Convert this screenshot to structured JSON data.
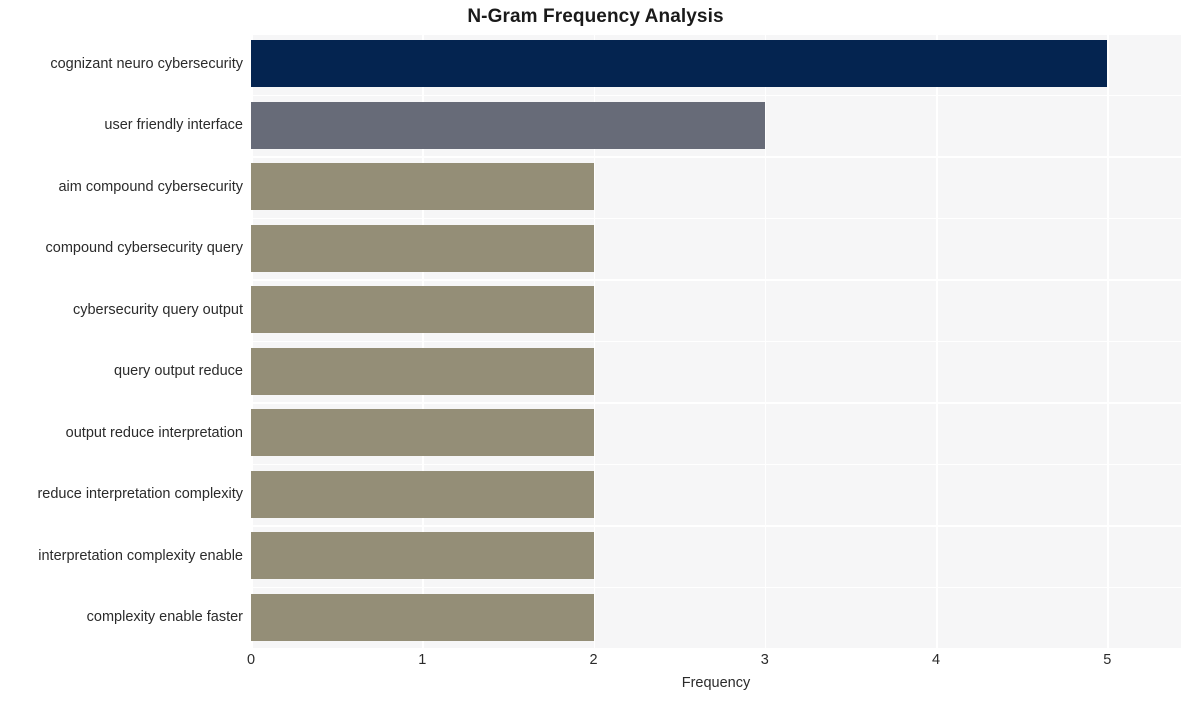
{
  "chart_data": {
    "type": "bar",
    "orientation": "horizontal",
    "title": "N-Gram Frequency Analysis",
    "xlabel": "Frequency",
    "ylabel": "",
    "categories": [
      "cognizant neuro cybersecurity",
      "user friendly interface",
      "aim compound cybersecurity",
      "compound cybersecurity query",
      "cybersecurity query output",
      "query output reduce",
      "output reduce interpretation",
      "reduce interpretation complexity",
      "interpretation complexity enable",
      "complexity enable faster"
    ],
    "values": [
      5,
      3,
      2,
      2,
      2,
      2,
      2,
      2,
      2,
      2
    ],
    "bar_colors": [
      "#042450",
      "#676b78",
      "#948e77",
      "#948e77",
      "#948e77",
      "#948e77",
      "#948e77",
      "#948e77",
      "#948e77",
      "#948e77"
    ],
    "xlim": [
      0,
      5.43
    ],
    "xticks": [
      0,
      1,
      2,
      3,
      4,
      5
    ],
    "xtick_labels": [
      "0",
      "1",
      "2",
      "3",
      "4",
      "5"
    ],
    "grid": true,
    "grid_color": "#ffffff",
    "plot_background": "#f6f6f7",
    "figure_background": "#ffffff",
    "legend": null
  }
}
